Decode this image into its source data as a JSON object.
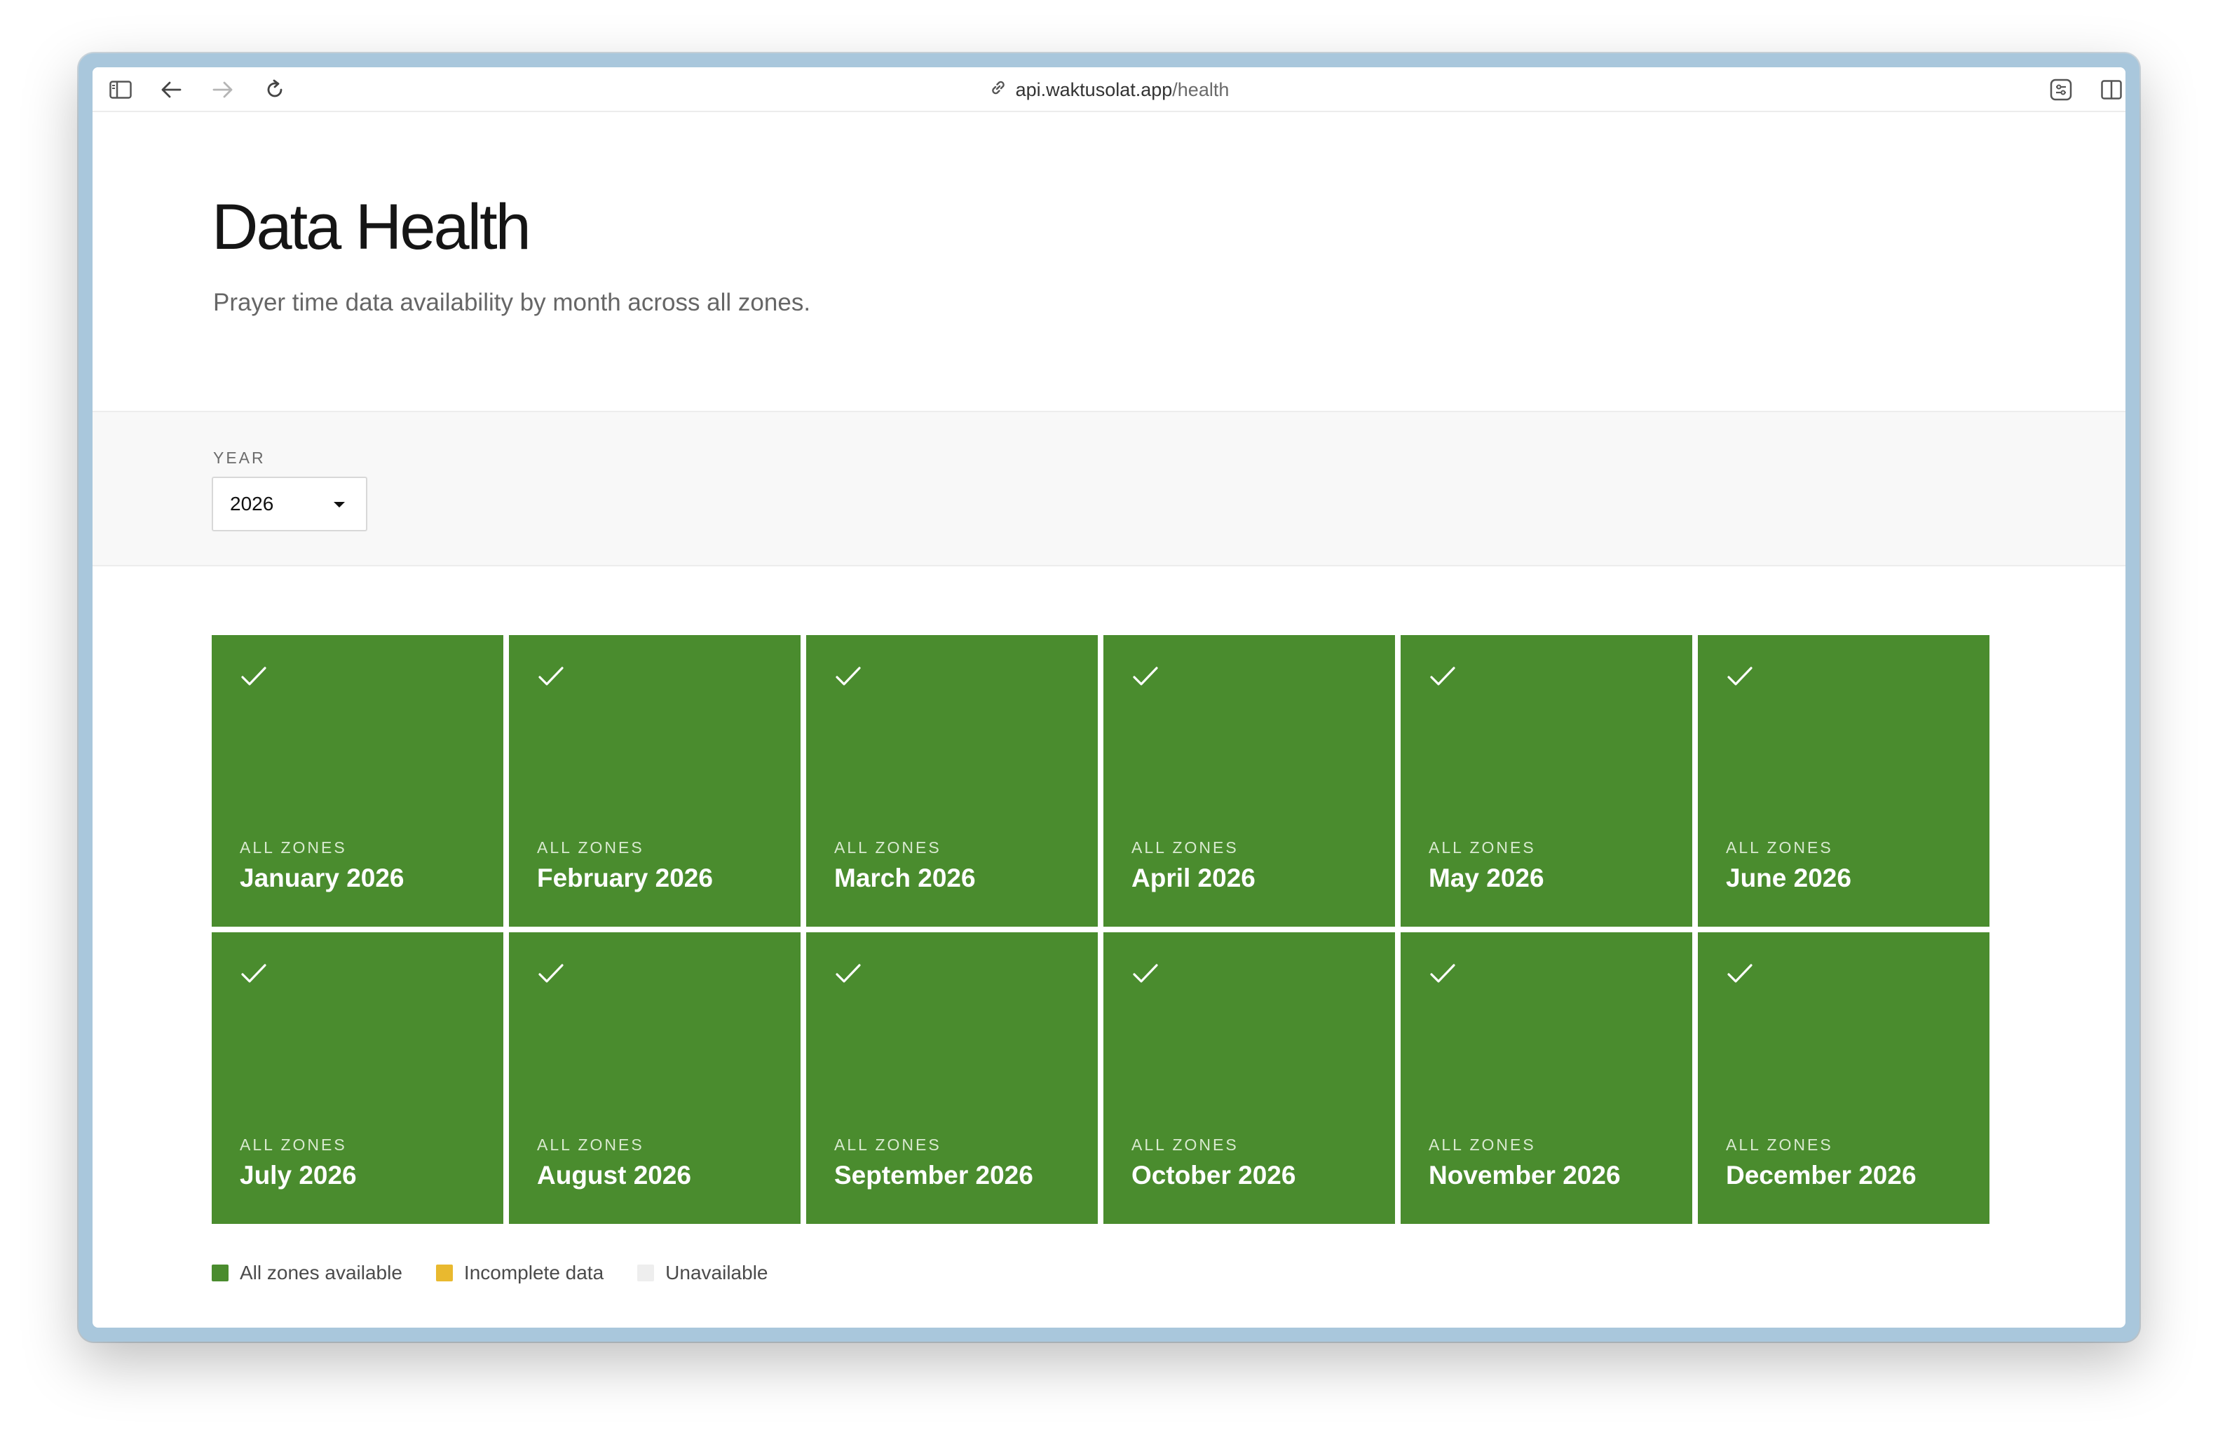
{
  "browser": {
    "url_host": "api.waktusolat.app",
    "url_path": "/health"
  },
  "page": {
    "title": "Data Health",
    "subtitle": "Prayer time data availability by month across all zones."
  },
  "filter": {
    "year_label": "YEAR",
    "year_value": "2026"
  },
  "months": [
    {
      "zones": "ALL ZONES",
      "label": "January 2026"
    },
    {
      "zones": "ALL ZONES",
      "label": "February 2026"
    },
    {
      "zones": "ALL ZONES",
      "label": "March 2026"
    },
    {
      "zones": "ALL ZONES",
      "label": "April 2026"
    },
    {
      "zones": "ALL ZONES",
      "label": "May 2026"
    },
    {
      "zones": "ALL ZONES",
      "label": "June 2026"
    },
    {
      "zones": "ALL ZONES",
      "label": "July 2026"
    },
    {
      "zones": "ALL ZONES",
      "label": "August 2026"
    },
    {
      "zones": "ALL ZONES",
      "label": "September 2026"
    },
    {
      "zones": "ALL ZONES",
      "label": "October 2026"
    },
    {
      "zones": "ALL ZONES",
      "label": "November 2026"
    },
    {
      "zones": "ALL ZONES",
      "label": "December 2026"
    }
  ],
  "legend": [
    {
      "label": "All zones available",
      "color": "#4a8c2e"
    },
    {
      "label": "Incomplete data",
      "color": "#e9b92f"
    },
    {
      "label": "Unavailable",
      "color": "#eeeeee"
    }
  ],
  "colors": {
    "available": "#4a8c2e"
  }
}
